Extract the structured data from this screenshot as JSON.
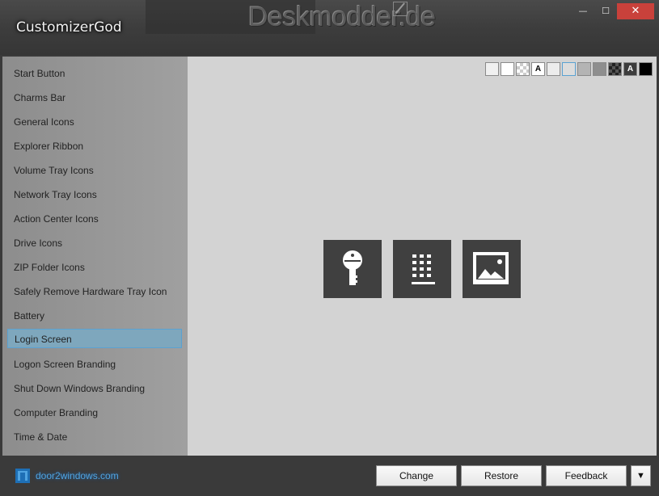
{
  "window": {
    "title": "CustomizerGod",
    "watermark": "Deskmodder.de",
    "min_glyph": "—",
    "max_glyph": "☐",
    "close_glyph": "✕"
  },
  "sidebar": {
    "items": [
      {
        "label": "Start Button"
      },
      {
        "label": "Charms Bar"
      },
      {
        "label": "General Icons"
      },
      {
        "label": "Explorer Ribbon"
      },
      {
        "label": "Volume Tray Icons"
      },
      {
        "label": "Network Tray Icons"
      },
      {
        "label": "Action Center Icons"
      },
      {
        "label": "Drive Icons"
      },
      {
        "label": "ZIP Folder Icons"
      },
      {
        "label": "Safely Remove Hardware Tray Icon"
      },
      {
        "label": "Battery"
      },
      {
        "label": "Login Screen"
      },
      {
        "label": "Logon Screen Branding"
      },
      {
        "label": "Shut Down Windows Branding"
      },
      {
        "label": "Computer Branding"
      },
      {
        "label": "Time & Date"
      }
    ],
    "selected_index": 11,
    "selected_color": "#7ea7bd"
  },
  "swatches": {
    "letter": "A",
    "colors": [
      "#f0f0f0",
      "#ffffff",
      "checker",
      "#ffffff",
      "#ececec",
      "#dcdcdc",
      "#b4b4b4",
      "#8e8e8e",
      "checker-dark",
      "#3c3c3c",
      "#000000"
    ]
  },
  "tiles": [
    {
      "icon": "key-icon"
    },
    {
      "icon": "keypad-icon"
    },
    {
      "icon": "picture-icon"
    }
  ],
  "footer": {
    "brand": "door2windows.com",
    "change_label": "Change",
    "restore_label": "Restore",
    "feedback_label": "Feedback",
    "dropdown_glyph": "▼"
  }
}
